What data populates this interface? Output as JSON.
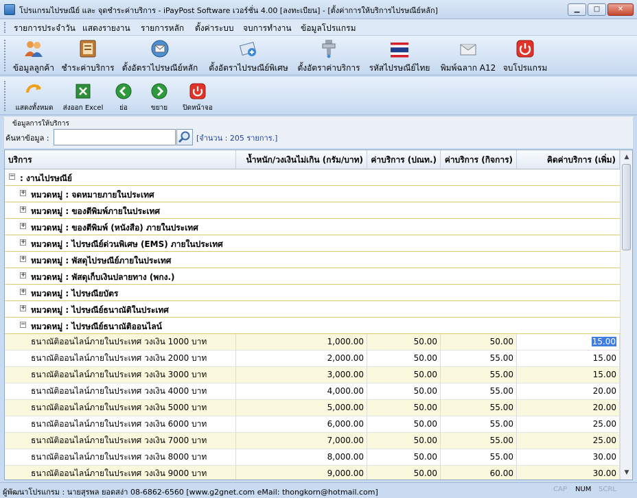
{
  "window": {
    "title": "โปรแกรมไปรษณีย์ และ จุดชำระค่าบริการ - iPayPost Software เวอร์ชั่น 4.00 [ลงทะเบียน] - [ตั้งค่าการให้บริการไปรษณีย์หลัก]",
    "min_glyph": "▁",
    "max_glyph": "□",
    "close_glyph": "✕"
  },
  "menu": {
    "items": [
      "รายการประจำวัน",
      "แสดงรายงาน",
      "รายการหลัก",
      "ตั้งค่าระบบ",
      "จบการทำงาน",
      "ข้อมูลโปรแกรม"
    ]
  },
  "toolbar": {
    "items": [
      {
        "label": "ข้อมูลลูกค้า",
        "icon": "customers-icon"
      },
      {
        "label": "ชำระค่าบริการ",
        "icon": "payment-book-icon"
      },
      {
        "label": "ตั้งอัตราไปรษณีย์หลัก",
        "icon": "mail-globe-icon"
      },
      {
        "label": "ตั้งอัตราไปรษณีย์พิเศษ",
        "icon": "special-mail-icon"
      },
      {
        "label": "ตั้งอัตราค่าบริการ",
        "icon": "service-rate-icon"
      },
      {
        "label": "รหัสไปรษณีย์ไทย",
        "icon": "thai-flag-icon"
      },
      {
        "label": "พิมพ์ฉลาก A12",
        "icon": "envelope-icon"
      },
      {
        "label": "จบโปรแกรม",
        "icon": "power-icon"
      }
    ]
  },
  "toolbar2": {
    "items": [
      {
        "label": "แสดงทั้งหมด",
        "icon": "show-all-icon"
      },
      {
        "label": "ส่งออก Excel",
        "icon": "excel-icon"
      },
      {
        "label": "ย่อ",
        "icon": "collapse-icon"
      },
      {
        "label": "ขยาย",
        "icon": "expand-icon"
      },
      {
        "label": "ปิดหน้าจอ",
        "icon": "close-screen-icon"
      }
    ]
  },
  "search": {
    "caption": "ข้อมูลการให้บริการ",
    "label": "ค้นหาข้อมูล :",
    "value": "",
    "placeholder": "",
    "count_text": "[จำนวน : 205 รายการ.]"
  },
  "grid": {
    "headers": [
      "บริการ",
      "น้ำหนัก/วงเงินไม่เกิน (กรัม/บาท)",
      "ค่าบริการ (ปณท.)",
      "ค่าบริการ (กิจการ)",
      "คิดค่าบริการ (เพิ่ม)"
    ],
    "root_group": {
      "label": ": งานไปรษณีย์",
      "toggle": "−"
    },
    "categories": [
      {
        "label": "หมวดหมู่ : จดหมายภายในประเทศ",
        "toggle": "+"
      },
      {
        "label": "หมวดหมู่ : ของตีพิมพ์ภายในประเทศ",
        "toggle": "+"
      },
      {
        "label": "หมวดหมู่ : ของตีพิมพ์ (หนังสือ) ภายในประเทศ",
        "toggle": "+"
      },
      {
        "label": "หมวดหมู่ : ไปรษณีย์ด่วนพิเศษ (EMS) ภายในประเทศ",
        "toggle": "+"
      },
      {
        "label": "หมวดหมู่ : พัสดุไปรษณีย์ภายในประเทศ",
        "toggle": "+"
      },
      {
        "label": "หมวดหมู่ : พัสดุเก็บเงินปลายทาง (พกง.)",
        "toggle": "+"
      },
      {
        "label": "หมวดหมู่ : ไปรษณียบัตร",
        "toggle": "+"
      },
      {
        "label": "หมวดหมู่ : ไปรษณีย์ธนาณัติในประเทศ",
        "toggle": "+"
      },
      {
        "label": "หมวดหมู่ : ไปรษณีย์ธนาณัติออนไลน์",
        "toggle": "−"
      }
    ],
    "rows": [
      {
        "service": "ธนาณัติออนไลน์ภายในประเทศ วงเงิน 1000 บาท",
        "limit": "1,000.00",
        "fee_post": "50.00",
        "fee_biz": "50.00",
        "extra": "15.00"
      },
      {
        "service": "ธนาณัติออนไลน์ภายในประเทศ วงเงิน 2000 บาท",
        "limit": "2,000.00",
        "fee_post": "50.00",
        "fee_biz": "55.00",
        "extra": "15.00"
      },
      {
        "service": "ธนาณัติออนไลน์ภายในประเทศ วงเงิน 3000 บาท",
        "limit": "3,000.00",
        "fee_post": "50.00",
        "fee_biz": "55.00",
        "extra": "15.00"
      },
      {
        "service": "ธนาณัติออนไลน์ภายในประเทศ วงเงิน 4000 บาท",
        "limit": "4,000.00",
        "fee_post": "50.00",
        "fee_biz": "55.00",
        "extra": "20.00"
      },
      {
        "service": "ธนาณัติออนไลน์ภายในประเทศ วงเงิน 5000 บาท",
        "limit": "5,000.00",
        "fee_post": "50.00",
        "fee_biz": "55.00",
        "extra": "20.00"
      },
      {
        "service": "ธนาณัติออนไลน์ภายในประเทศ วงเงิน 6000 บาท",
        "limit": "6,000.00",
        "fee_post": "50.00",
        "fee_biz": "55.00",
        "extra": "25.00"
      },
      {
        "service": "ธนาณัติออนไลน์ภายในประเทศ วงเงิน 7000 บาท",
        "limit": "7,000.00",
        "fee_post": "50.00",
        "fee_biz": "55.00",
        "extra": "25.00"
      },
      {
        "service": "ธนาณัติออนไลน์ภายในประเทศ วงเงิน 8000 บาท",
        "limit": "8,000.00",
        "fee_post": "50.00",
        "fee_biz": "55.00",
        "extra": "30.00"
      },
      {
        "service": "ธนาณัติออนไลน์ภายในประเทศ วงเงิน 9000 บาท",
        "limit": "9,000.00",
        "fee_post": "50.00",
        "fee_biz": "60.00",
        "extra": "30.00"
      }
    ],
    "scroll_up": "▲",
    "scroll_down": "▼"
  },
  "status": {
    "message": "ผู้พัฒนาโปรแกรม : นายสุรพล ยอดสง่า 08-6862-6560  [www.g2gnet.com  eMail: thongkorn@hotmail.com]",
    "cap": "CAP",
    "num": "NUM",
    "scrl": "SCRL"
  },
  "colors": {
    "accent": "#3f7ee0",
    "group_line": "#e6c76c",
    "odd_row": "#fbf9dd",
    "count_text": "#1c3e9c"
  }
}
